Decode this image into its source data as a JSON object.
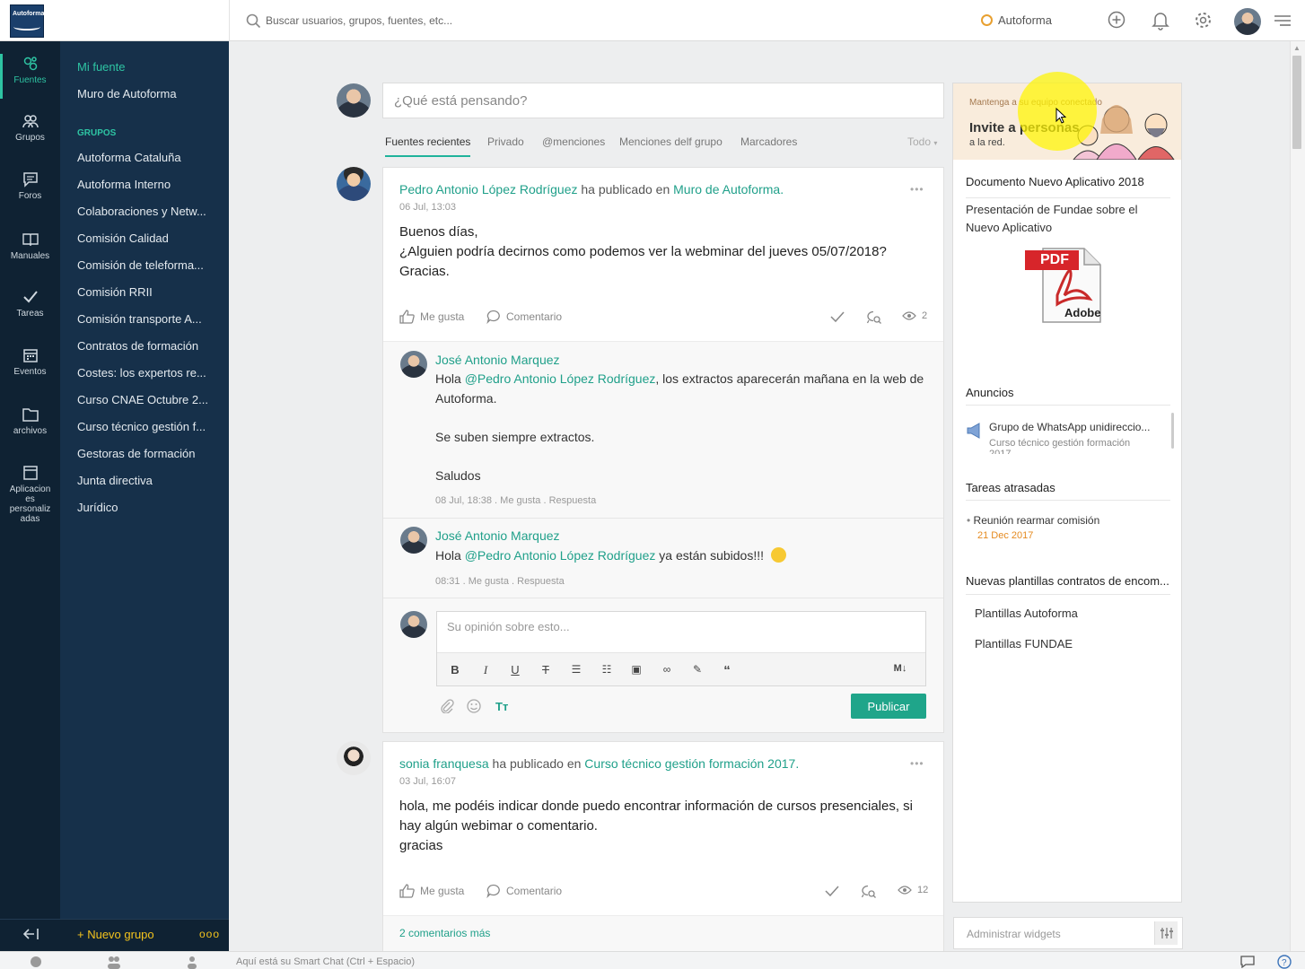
{
  "topbar": {
    "logo_text": "Autoforma",
    "search_placeholder": "Buscar usuarios, grupos, fuentes, etc...",
    "org_name": "Autoforma"
  },
  "leftnav": [
    {
      "label": "Fuentes",
      "icon": "sources-icon"
    },
    {
      "label": "Grupos",
      "icon": "groups-icon"
    },
    {
      "label": "Foros",
      "icon": "forum-icon"
    },
    {
      "label": "Manuales",
      "icon": "book-icon"
    },
    {
      "label": "Tareas",
      "icon": "check-icon"
    },
    {
      "label": "Eventos",
      "icon": "calendar-icon"
    },
    {
      "label": "archivos",
      "icon": "folder-icon"
    },
    {
      "label": "Aplicacion es personaliz adas",
      "icon": "app-icon"
    }
  ],
  "groupnav": {
    "my_feed": "Mi fuente",
    "wall": "Muro de Autoforma",
    "groups_header": "GRUPOS",
    "groups": [
      "Autoforma Cataluña",
      "Autoforma Interno",
      "Colaboraciones y Netw...",
      "Comisión Calidad",
      "Comisión de teleforma...",
      "Comisión RRII",
      "Comisión transporte A...",
      "Contratos de formación",
      "Costes: los expertos re...",
      "Curso CNAE Octubre 2...",
      "Curso técnico gestión f...",
      "Gestoras de formación",
      "Junta directiva",
      "Jurídico"
    ],
    "new_group": "+ Nuevo grupo",
    "more": "ooo"
  },
  "composer": {
    "placeholder": "¿Qué está pensando?",
    "tabs": [
      "Fuentes recientes",
      "Privado",
      "@menciones",
      "Menciones delf grupo",
      "Marcadores"
    ],
    "filter": "Todo"
  },
  "post1": {
    "author": "Pedro Antonio López Rodríguez",
    "verb": "ha publicado en",
    "target": "Muro de Autoforma.",
    "date": "06 Jul, 13:03",
    "lines": [
      "Buenos días,",
      "¿Alguien podría decirnos como podemos ver la webminar del jueves 05/07/2018?",
      "Gracias."
    ],
    "like": "Me gusta",
    "comment": "Comentario",
    "views": "2",
    "comments": [
      {
        "author": "José Antonio Marquez",
        "greeting": "Hola ",
        "mention": "@Pedro Antonio López Rodríguez",
        "text1": ", los extractos aparecerán mañana en la web de",
        "text2": "Autoforma.",
        "text3": "Se suben siempre extractos.",
        "text4": "Saludos",
        "time": "08 Jul, 18:38",
        "like": "Me gusta",
        "reply": "Respuesta"
      },
      {
        "author": "José Antonio Marquez",
        "greeting": "Hola ",
        "mention": "@Pedro Antonio López Rodríguez",
        "text1": " ya están subidos!!!",
        "time": "08:31",
        "like": "Me gusta",
        "reply": "Respuesta"
      }
    ],
    "reply_placeholder": "Su opinión sobre esto...",
    "publish": "Publicar",
    "md": "M↓"
  },
  "post2": {
    "author": "sonia franquesa",
    "verb": "ha publicado en",
    "target": "Curso técnico gestión formación 2017.",
    "date": "03 Jul, 16:07",
    "lines": [
      "hola, me podéis indicar donde puedo encontrar información de cursos presenciales, si",
      "hay algún webimar o comentario.",
      "gracias"
    ],
    "like": "Me gusta",
    "comment": "Comentario",
    "views": "12",
    "more_comments": "2 comentarios más"
  },
  "widgets": {
    "invite_small": "Mantenga a su equipo conectado",
    "invite_title": "Invite a personas",
    "invite_sub": "a la red.",
    "doc_title": "Documento Nuevo Aplicativo 2018",
    "doc_desc1": "Presentación de Fundae sobre el",
    "doc_desc2": "Nuevo Aplicativo",
    "pdf_label": "PDF",
    "pdf_brand": "Adobe",
    "ann_title": "Anuncios",
    "ann_item": "Grupo de WhatsApp unidireccio...",
    "ann_group": "Curso técnico gestión formación",
    "ann_year": "2017",
    "late_title": "Tareas atrasadas",
    "late_item": "Reunión rearmar comisión",
    "late_date": "21 Dec 2017",
    "tpl_title": "Nuevas plantillas contratos de encom...",
    "tpl_items": [
      "Plantillas Autoforma",
      "Plantillas FUNDAE"
    ],
    "admin": "Administrar widgets"
  },
  "footer": {
    "smartchat": "Aquí está su Smart Chat (Ctrl + Espacio)"
  },
  "colors": {
    "accent": "#20a08a",
    "nav_bg": "#0f2233",
    "group_bg": "#16304a",
    "new_group": "#f3c31d"
  }
}
